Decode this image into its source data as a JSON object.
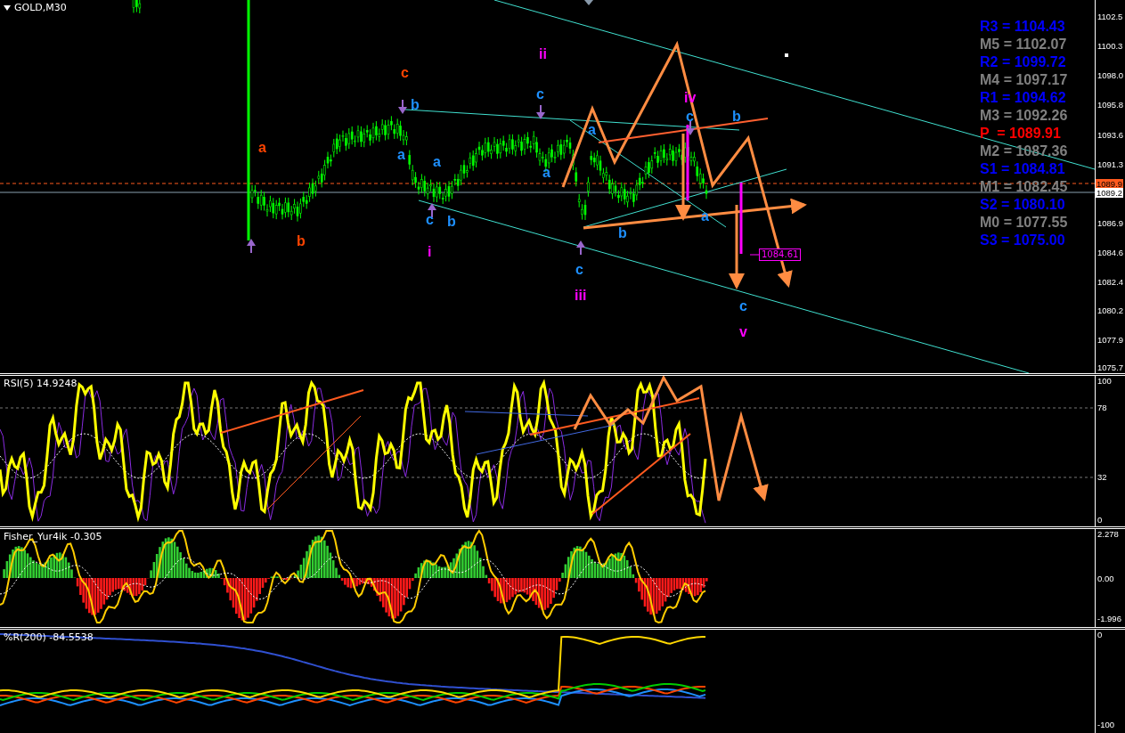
{
  "chart_window": {
    "title": "GOLD,M30"
  },
  "price_panel": {
    "axis_ticks": [
      "1102.5",
      "1100.3",
      "1098.0",
      "1095.8",
      "1093.6",
      "1091.3",
      "1086.9",
      "1084.6",
      "1082.4",
      "1080.2",
      "1077.9",
      "1075.7"
    ],
    "bid_tag": "1089.9",
    "last_tag": "1089.2",
    "price_label": "1084.61",
    "wave_labels": [
      {
        "text": "c",
        "color": "#ff4400"
      },
      {
        "text": "a",
        "color": "#ff4400"
      },
      {
        "text": "b",
        "color": "#ff4400"
      },
      {
        "text": "ii",
        "color": "#ff00ff"
      },
      {
        "text": "c",
        "color": "#1e90ff"
      },
      {
        "text": "b",
        "color": "#1e90ff"
      },
      {
        "text": "a",
        "color": "#1e90ff"
      },
      {
        "text": "a",
        "color": "#1e90ff"
      },
      {
        "text": "a",
        "color": "#1e90ff"
      },
      {
        "text": "c",
        "color": "#1e90ff"
      },
      {
        "text": "b",
        "color": "#1e90ff"
      },
      {
        "text": "i",
        "color": "#ff00ff"
      },
      {
        "text": "a",
        "color": "#1e90ff"
      },
      {
        "text": "b",
        "color": "#1e90ff"
      },
      {
        "text": "c",
        "color": "#1e90ff"
      },
      {
        "text": "iii",
        "color": "#ff00ff"
      },
      {
        "text": "iv",
        "color": "#ff00ff"
      },
      {
        "text": "c",
        "color": "#1e90ff"
      },
      {
        "text": "b",
        "color": "#1e90ff"
      },
      {
        "text": "a",
        "color": "#1e90ff"
      },
      {
        "text": "c",
        "color": "#1e90ff"
      },
      {
        "text": "v",
        "color": "#ff00ff"
      }
    ],
    "pivot_levels": [
      {
        "text": "R3 = 1104.43",
        "color": "#0000ff"
      },
      {
        "text": "M5 = 1102.07",
        "color": "#808080"
      },
      {
        "text": "R2 = 1099.72",
        "color": "#0000ff"
      },
      {
        "text": "M4 = 1097.17",
        "color": "#808080"
      },
      {
        "text": "R1 = 1094.62",
        "color": "#0000ff"
      },
      {
        "text": "M3 = 1092.26",
        "color": "#808080"
      },
      {
        "text": "P  = 1089.91",
        "color": "#ff0000"
      },
      {
        "text": "M2 = 1087.36",
        "color": "#808080"
      },
      {
        "text": "S1 = 1084.81",
        "color": "#0000ff"
      },
      {
        "text": "M1 = 1082.45",
        "color": "#808080"
      },
      {
        "text": "S2 = 1080.10",
        "color": "#0000ff"
      },
      {
        "text": "M0 = 1077.55",
        "color": "#808080"
      },
      {
        "text": "S3 = 1075.00",
        "color": "#0000ff"
      }
    ]
  },
  "indicators": [
    {
      "kind": "rsi",
      "title": "RSI(5) 14.9248",
      "axis_ticks": [
        "100",
        "78",
        "32",
        "0"
      ]
    },
    {
      "kind": "fisher",
      "title": "Fisher_Yur4ik -0.305",
      "axis_ticks": [
        "2.278",
        "0.00",
        "-1.996"
      ]
    },
    {
      "kind": "wpr",
      "title": "%R(200) -84.5538",
      "axis_ticks": [
        "0",
        "-100"
      ]
    }
  ]
}
